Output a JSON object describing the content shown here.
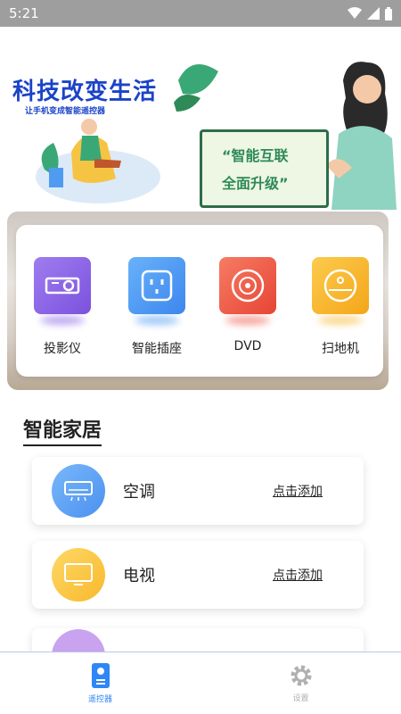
{
  "status_bar": {
    "time": "5:21"
  },
  "banner": {
    "slogan": "科技改变生活",
    "subslogan": "让手机变成智能遥控器",
    "board_line1": "“智能互联",
    "board_line2": "全面升级”"
  },
  "devices": [
    {
      "label": "投影仪",
      "icon": "projector-icon",
      "color": "#8a63e6"
    },
    {
      "label": "智能插座",
      "icon": "socket-icon",
      "color": "#4f9bf2"
    },
    {
      "label": "DVD",
      "icon": "dvd-icon",
      "color": "#ef5a4b"
    },
    {
      "label": "扫地机",
      "icon": "robot-vacuum-icon",
      "color": "#f7b731"
    }
  ],
  "section": {
    "title": "智能家居"
  },
  "home_items": [
    {
      "name": "空调",
      "action": "点击添加",
      "icon": "air-conditioner-icon",
      "color": "#5aa2f5"
    },
    {
      "name": "电视",
      "action": "点击添加",
      "icon": "tv-icon",
      "color": "#fcc842"
    }
  ],
  "tabbar": {
    "tabs": [
      {
        "label": "遥控器",
        "icon": "remote-icon",
        "active": true
      },
      {
        "label": "设置",
        "icon": "gear-icon",
        "active": false
      }
    ]
  },
  "colors": {
    "accent": "#2f86f6",
    "inactive": "#b0b0b0"
  }
}
